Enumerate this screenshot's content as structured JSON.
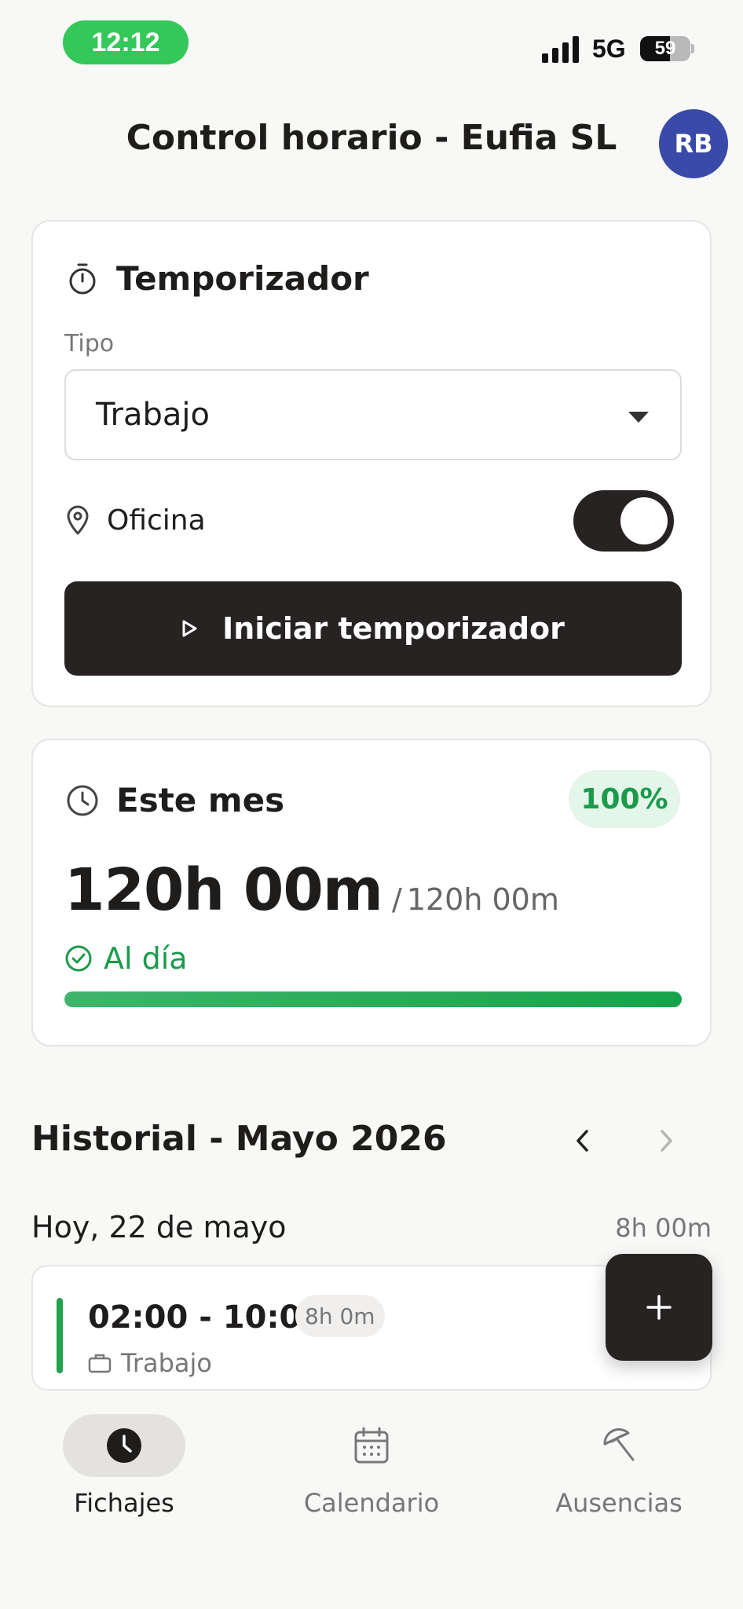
{
  "status_bar": {
    "time": "12:12",
    "network": "5G",
    "battery": "59",
    "battery_level": 0.59
  },
  "header": {
    "title": "Control horario - Eufia SL",
    "avatar_initials": "RB",
    "avatar_color": "#3a4aa8"
  },
  "timer_card": {
    "heading": "Temporizador",
    "heading_icon": "stopwatch-icon",
    "tipo_label": "Tipo",
    "tipo_value": "Trabajo",
    "location_icon": "map-pin-icon",
    "location_label": "Oficina",
    "location_toggle_on": true,
    "start_button_label": "Iniciar temporizador",
    "start_button_icon": "play-icon"
  },
  "month_card": {
    "heading": "Este mes",
    "heading_icon": "clock-icon",
    "percent_badge": "100%",
    "hours_worked": "120h 00m",
    "hours_separator": "/",
    "hours_target": "120h 00m",
    "status_icon": "check-circle-icon",
    "status_text": "Al día",
    "progress": 1.0,
    "accent_color": "#1a9b4b"
  },
  "history": {
    "title": "Historial - Mayo 2026",
    "prev_icon": "chevron-left-icon",
    "next_icon": "chevron-right-icon",
    "days": [
      {
        "label": "Hoy, 22 de mayo",
        "total": "8h 00m",
        "entries": [
          {
            "time_range": "02:00 - 10:00",
            "duration": "8h 0m",
            "type_icon": "briefcase-icon",
            "type": "Trabajo"
          }
        ]
      }
    ]
  },
  "fab": {
    "icon": "plus-icon"
  },
  "bottom_nav": {
    "items": [
      {
        "label": "Fichajes",
        "icon": "clock-filled-icon",
        "active": true
      },
      {
        "label": "Calendario",
        "icon": "calendar-icon",
        "active": false
      },
      {
        "label": "Ausencias",
        "icon": "umbrella-icon",
        "active": false
      }
    ]
  }
}
